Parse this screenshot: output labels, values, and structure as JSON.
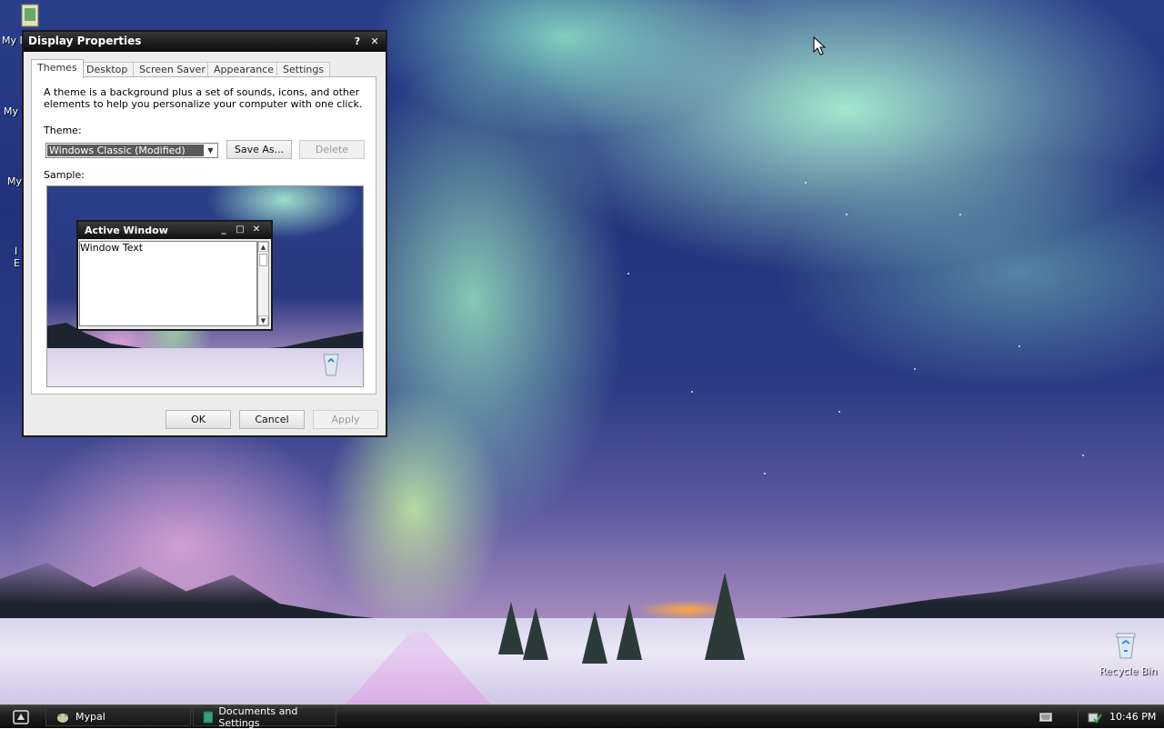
{
  "desktop": {
    "icons": [
      {
        "label": "My D",
        "icon": "my-documents-icon"
      },
      {
        "label": "My",
        "icon": "my-computer-icon"
      },
      {
        "label": "My",
        "icon": "my-network-icon"
      },
      {
        "label": "I",
        "icon": "internet-explorer-icon",
        "label2": "E"
      }
    ],
    "recycle_bin": {
      "label": "Recycle Bin",
      "icon": "recycle-bin-icon"
    }
  },
  "window": {
    "title": "Display Properties",
    "help_glyph": "?",
    "close_glyph": "✕",
    "tabs": [
      {
        "label": "Themes",
        "active": true
      },
      {
        "label": "Desktop",
        "active": false
      },
      {
        "label": "Screen Saver",
        "active": false
      },
      {
        "label": "Appearance",
        "active": false
      },
      {
        "label": "Settings",
        "active": false
      }
    ],
    "description": "A theme is a background plus a set of sounds, icons, and other elements to help you personalize your computer with one click.",
    "theme_label": "Theme:",
    "theme_value": "Windows Classic (Modified)",
    "save_as_label": "Save As...",
    "delete_label": "Delete",
    "sample_label": "Sample:",
    "sample": {
      "active_window_title": "Active Window",
      "window_text": "Window Text"
    },
    "ok_label": "OK",
    "cancel_label": "Cancel",
    "apply_label": "Apply"
  },
  "taskbar": {
    "tasks": [
      {
        "label": "Mypal",
        "icon": "mypal-browser-icon"
      },
      {
        "label": "Documents and Settings",
        "icon": "folder-icon"
      }
    ],
    "clock": "10:46 PM"
  },
  "colors": {
    "titlebar": "#1a1a1a",
    "dialog_face": "#ececec",
    "selected_value_bg": "#5a5a5a",
    "taskbar": "#111111"
  }
}
